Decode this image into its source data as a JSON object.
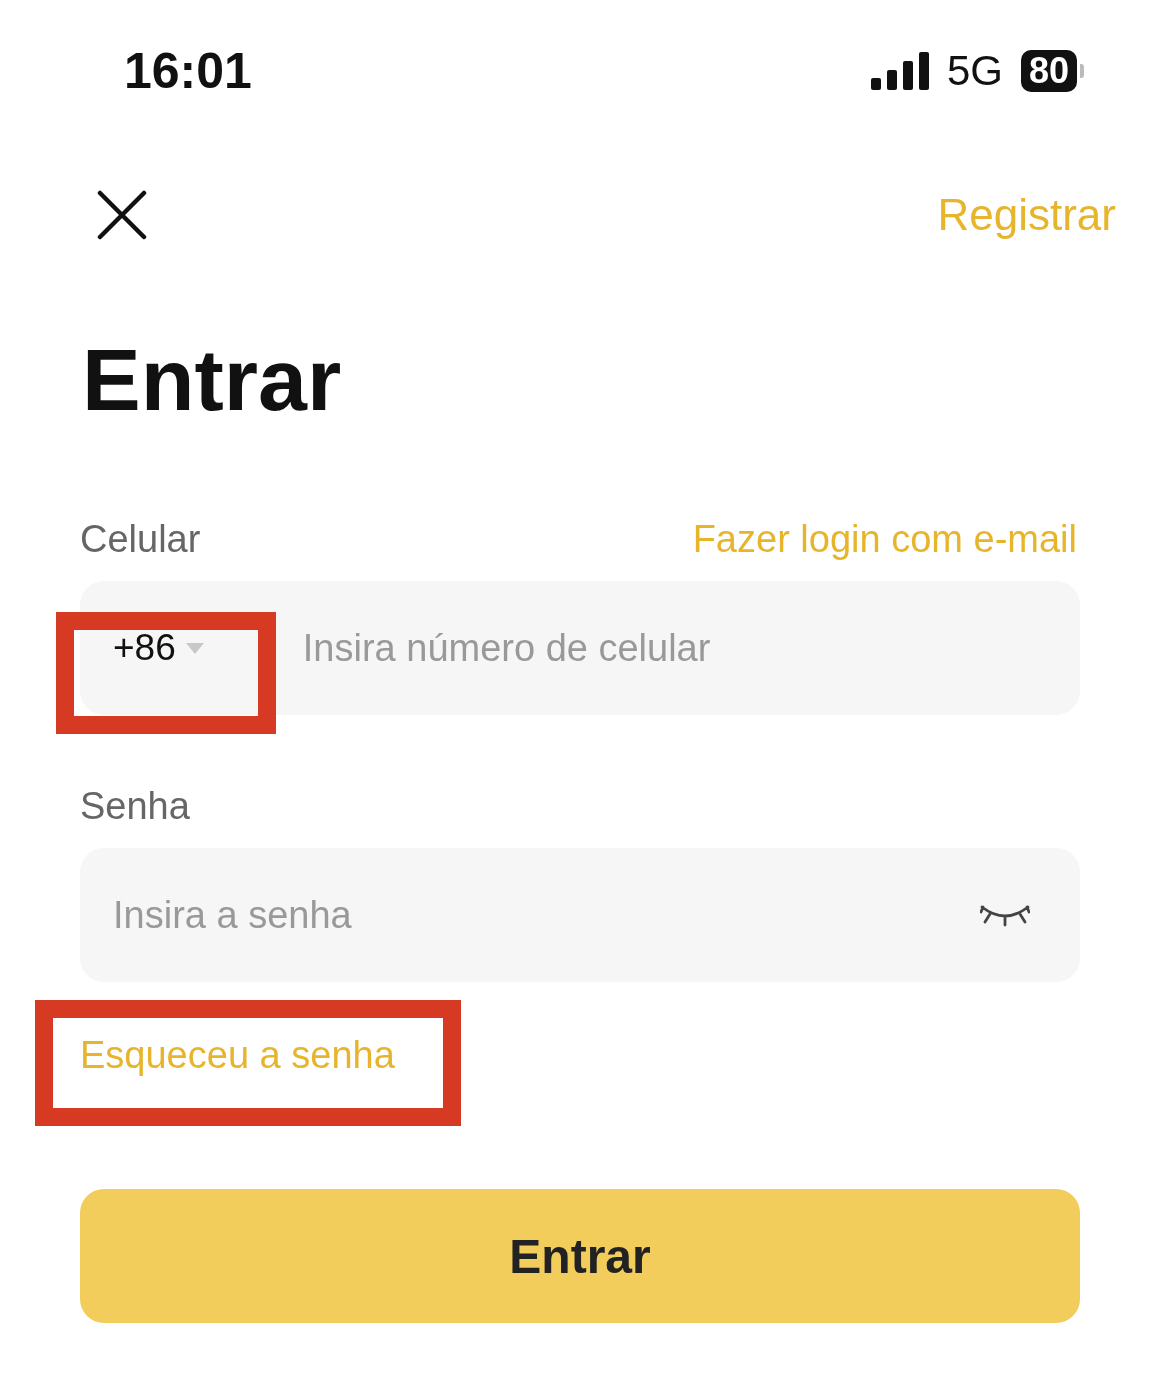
{
  "status_bar": {
    "time": "16:01",
    "network": "5G",
    "battery": "80"
  },
  "header": {
    "register_link": "Registrar"
  },
  "title": "Entrar",
  "phone": {
    "label": "Celular",
    "alt_login_link": "Fazer login com e-mail",
    "country_code": "+86",
    "country_code_highlighted": true,
    "placeholder": "Insira número de celular"
  },
  "password": {
    "label": "Senha",
    "placeholder": "Insira a senha"
  },
  "forgot_link": {
    "text": "Esqueceu a senha",
    "highlighted": true
  },
  "submit_button": "Entrar"
}
